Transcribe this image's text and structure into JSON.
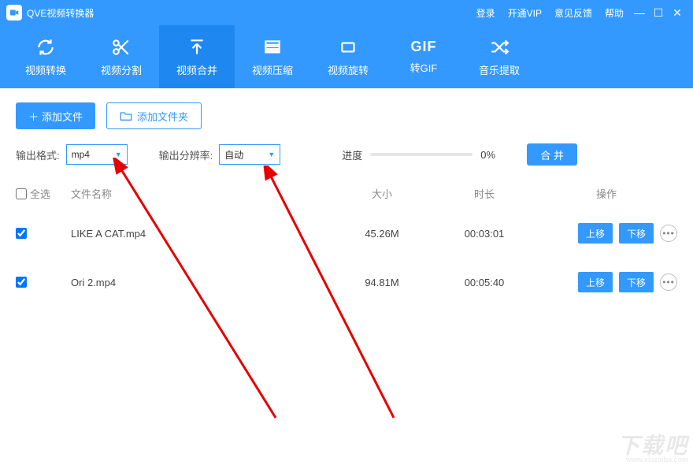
{
  "titlebar": {
    "app_name": "QVE视频转换器",
    "links": {
      "login": "登录",
      "vip": "开通VIP",
      "feedback": "意见反馈",
      "help": "帮助"
    }
  },
  "nav": {
    "convert": "视频转换",
    "split": "视频分割",
    "merge": "视频合并",
    "compress": "视频压缩",
    "rotate": "视频旋转",
    "gif": "转GIF",
    "gif_icon": "GIF",
    "audio": "音乐提取"
  },
  "toolbar": {
    "add_file": "添加文件",
    "add_folder": "添加文件夹"
  },
  "options": {
    "format_label": "输出格式:",
    "format_value": "mp4",
    "res_label": "输出分辨率:",
    "res_value": "自动",
    "progress_label": "进度",
    "progress_pct": "0%",
    "merge_btn": "合 并"
  },
  "table": {
    "select_all": "全选",
    "col_name": "文件名称",
    "col_size": "大小",
    "col_dur": "时长",
    "col_ops": "操作",
    "move_up": "上移",
    "move_down": "下移"
  },
  "rows": [
    {
      "name": "LIKE A CAT.mp4",
      "size": "45.26M",
      "duration": "00:03:01",
      "checked": true
    },
    {
      "name": "Ori 2.mp4",
      "size": "94.81M",
      "duration": "00:05:40",
      "checked": true
    }
  ],
  "watermark": {
    "big": "下载吧",
    "small": "www.xiazaiba.com"
  }
}
